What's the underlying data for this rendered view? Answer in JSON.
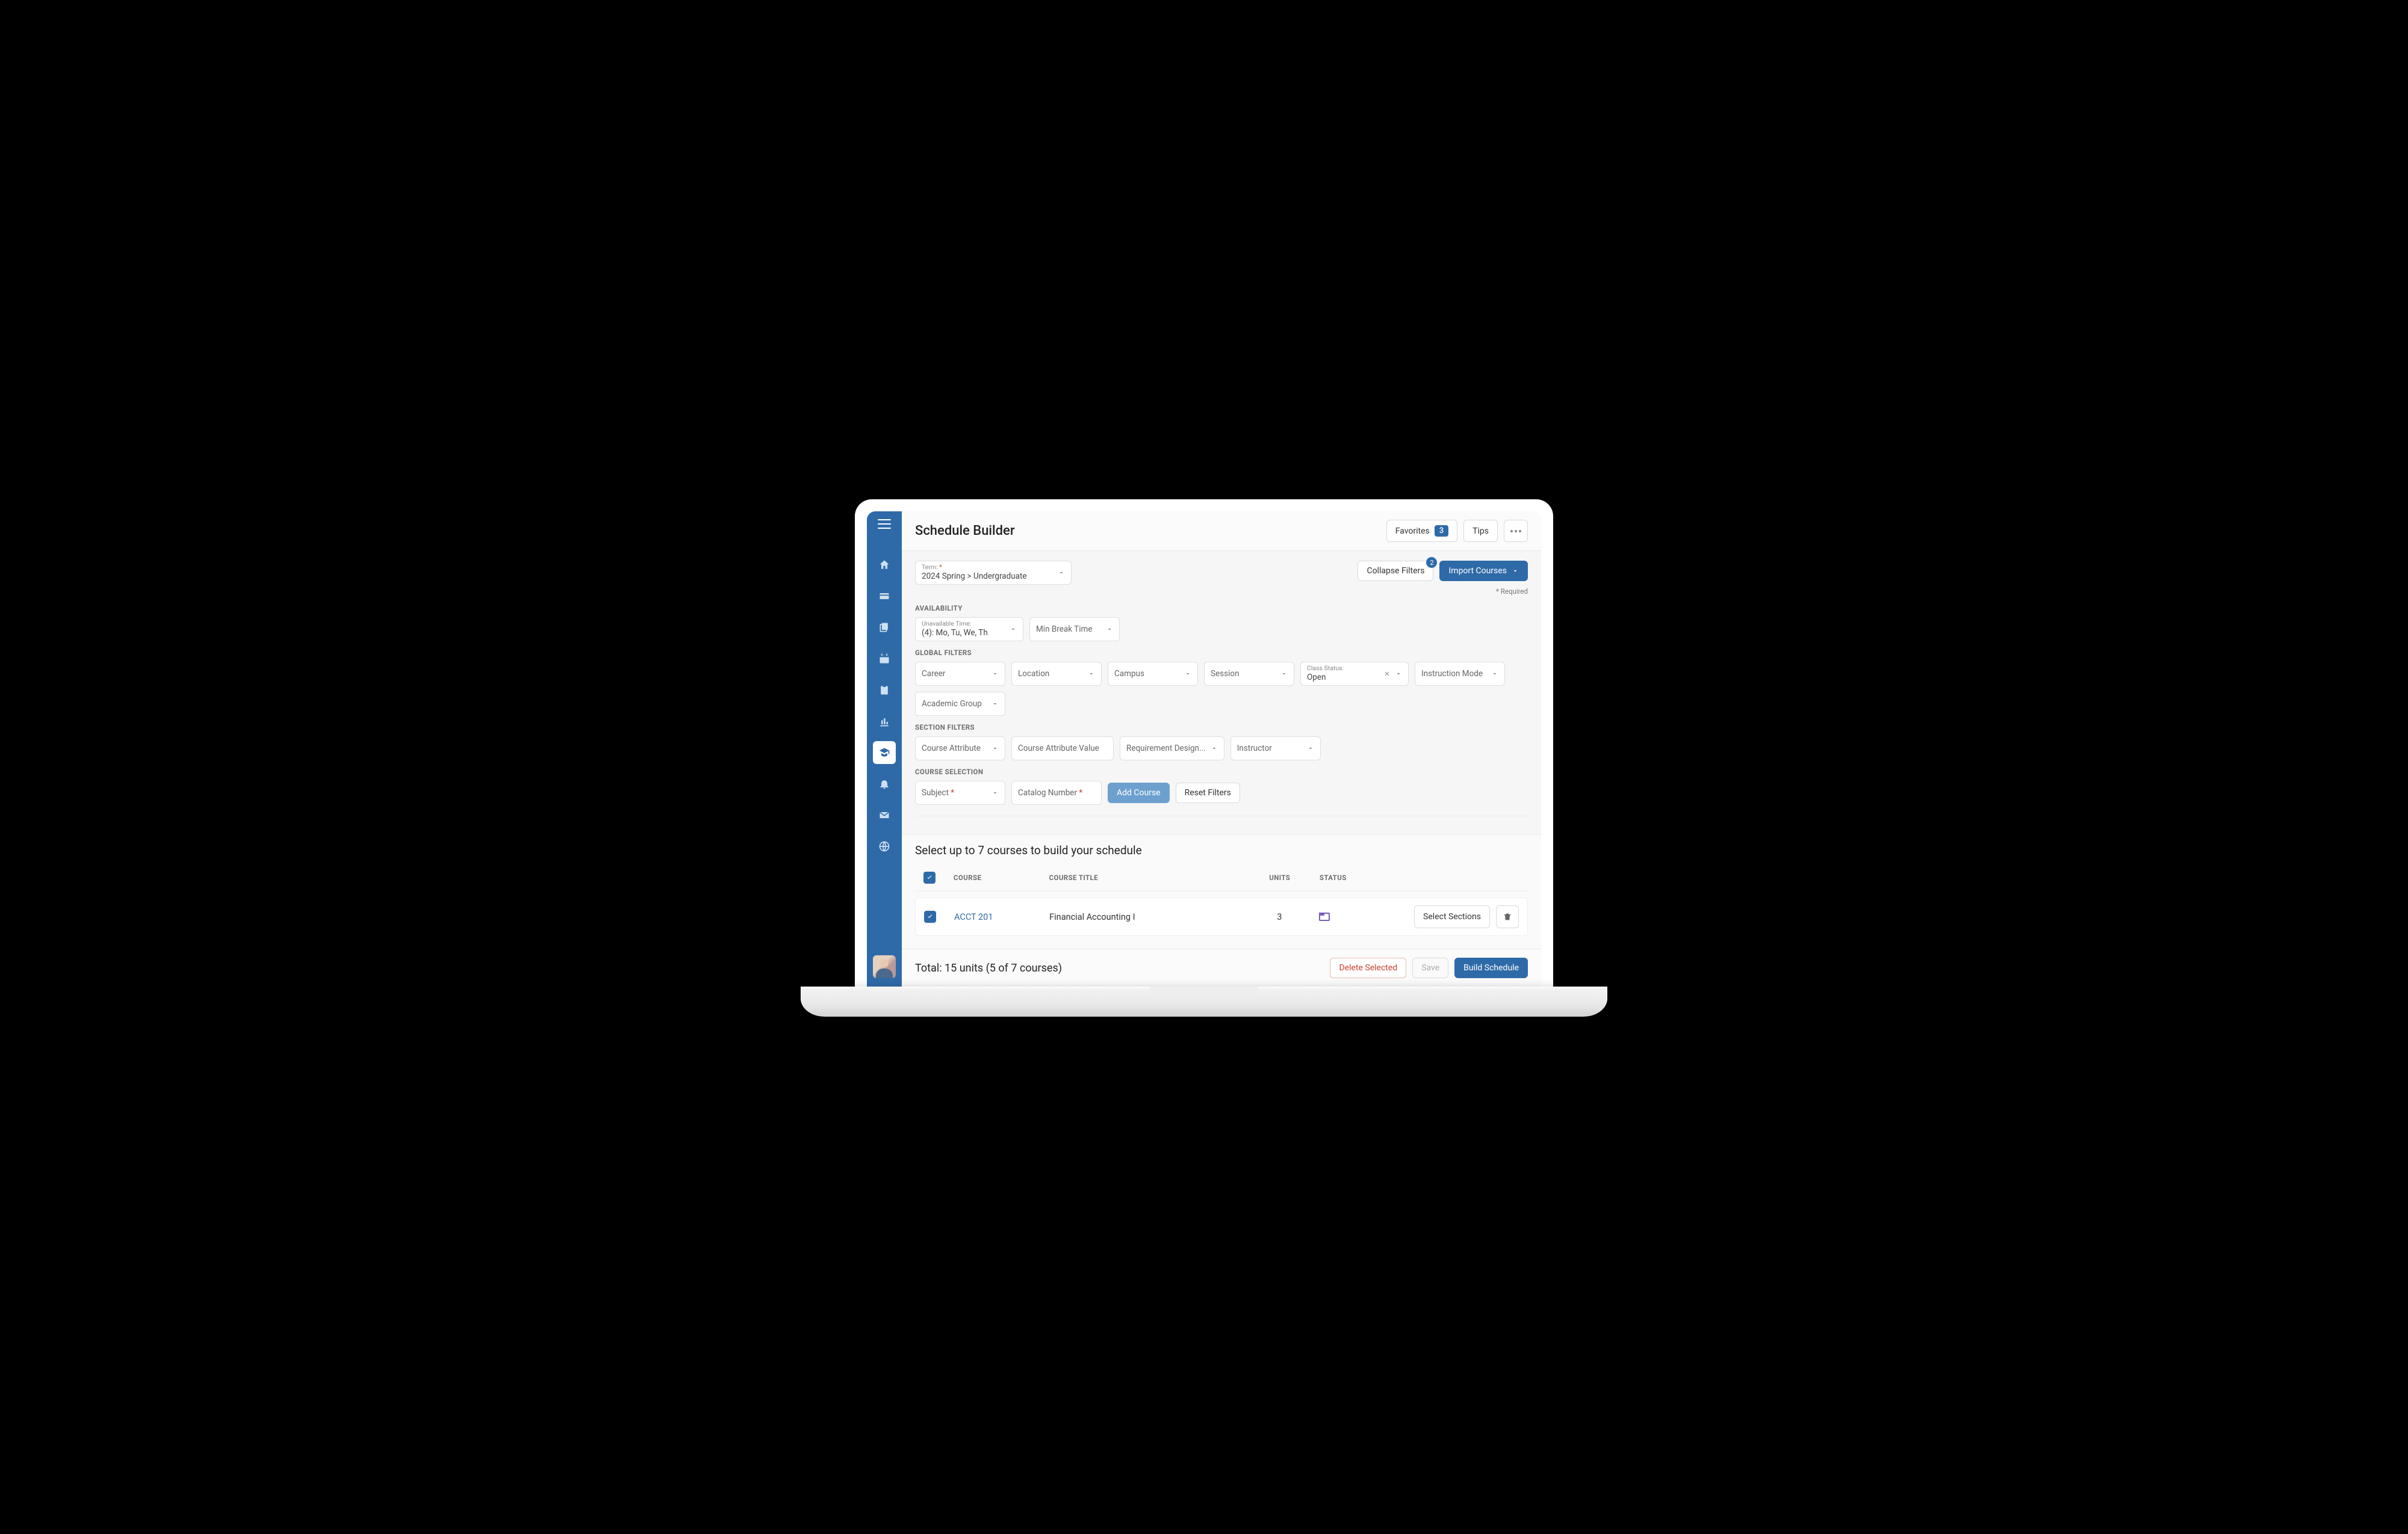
{
  "header": {
    "title": "Schedule Builder",
    "favorites_label": "Favorites",
    "favorites_count": "3",
    "tips_label": "Tips"
  },
  "term": {
    "label": "Term:",
    "value": "2024 Spring > Undergraduate"
  },
  "filter_buttons": {
    "collapse": "Collapse Filters",
    "collapse_badge": "2",
    "import": "Import Courses"
  },
  "required_note": "* Required",
  "sections": {
    "availability": "AVAILABILITY",
    "global_filters": "GLOBAL FILTERS",
    "section_filters": "SECTION FILTERS",
    "course_selection": "COURSE SELECTION"
  },
  "availability": {
    "unavailable_label": "Unavailable Time:",
    "unavailable_value": "(4): Mo, Tu, We, Th",
    "min_break": "Min Break Time"
  },
  "global": {
    "career": "Career",
    "location": "Location",
    "campus": "Campus",
    "session": "Session",
    "class_status_label": "Class Status:",
    "class_status_value": "Open",
    "instruction_mode": "Instruction Mode",
    "academic_group": "Academic Group"
  },
  "section_filters": {
    "course_attribute": "Course Attribute",
    "course_attribute_value": "Course Attribute Value",
    "requirement_designation": "Requirement Design...",
    "instructor": "Instructor"
  },
  "course_selection": {
    "subject": "Subject",
    "catalog_number": "Catalog Number",
    "add_course": "Add Course",
    "reset_filters": "Reset Filters"
  },
  "table": {
    "title": "Select up to 7 courses to build your schedule",
    "headers": {
      "course": "COURSE",
      "course_title": "COURSE TITLE",
      "units": "UNITS",
      "status": "STATUS"
    },
    "rows": [
      {
        "course": "ACCT 201",
        "title": "Financial Accounting I",
        "units": "3",
        "select_sections": "Select Sections"
      }
    ]
  },
  "bottom": {
    "total": "Total: 15 units (5 of 7 courses)",
    "delete": "Delete Selected",
    "save": "Save",
    "build": "Build Schedule"
  }
}
